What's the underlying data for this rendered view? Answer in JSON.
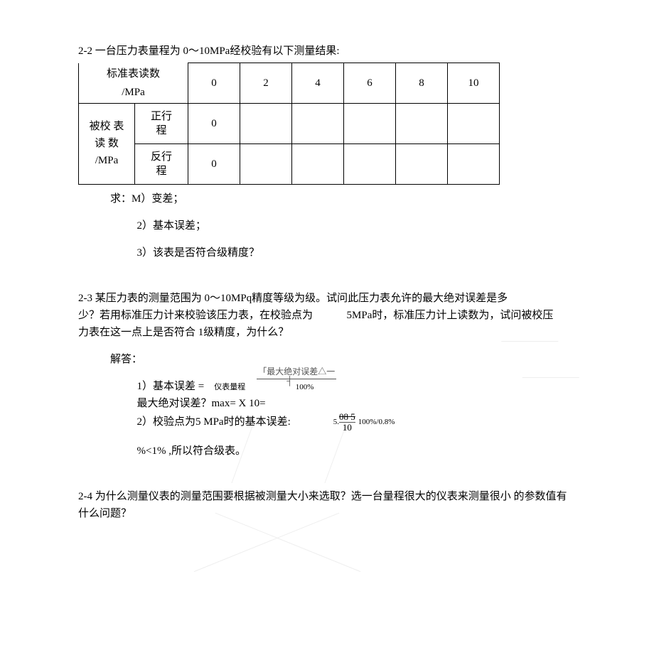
{
  "q22": {
    "heading": "2-2 一台压力表量程为 0～10MPa经校验有以下测量结果:",
    "table": {
      "header_label_top": "标准表读数",
      "header_label_bot": "/MPa",
      "row2_label_top": "被校 表",
      "row2_label_mid": "读 数",
      "row2_label_bot": "/MPa",
      "sub_forward_top": "正行",
      "sub_forward_bot": "程",
      "sub_backward_top": "反行",
      "sub_backward_bot": "程",
      "cols": [
        "0",
        "2",
        "4",
        "6",
        "8",
        "10"
      ],
      "forward0": "0",
      "backward0": "0"
    },
    "ask_lead": "求：M）变差；",
    "ask2": "2）基本误差；",
    "ask3": "3）该表是否符合级精度？"
  },
  "q23": {
    "p1": "2-3 某压力表的测量范围为 0～10MPq精度等级为级。试问此压力表允许的最大绝对误差是多",
    "p2a": "少？若用标准压力计来校验该压力表，在校验点为",
    "p2b": "5MPa时，标准压力计上读数为，试问被校压",
    "p3": "力表在这一点上是否符合 1级精度，为什么？",
    "ans_label": "解答：",
    "line1_a": "1）基本误差 =",
    "line1_b": "仪表量程",
    "frac_top": "「最大绝对误差△一",
    "arrow": "┤",
    "line1_c": "100%",
    "line2": "最大绝对误差？max= X 10=",
    "line3a": "2）校验点为5 MPa时的基本误差:",
    "line3b": "5.",
    "line3c": "08 5",
    "line3d": "100%/0.8%",
    "line3e": "10",
    "line4": "%<1% ,所以符合级表。"
  },
  "q24": {
    "p1": "2-4 为什么测量仪表的测量范围要根据被测量大小来选取？选一台量程很大的仪表来测量很小 的参数值有",
    "p2": "什么问题？"
  }
}
